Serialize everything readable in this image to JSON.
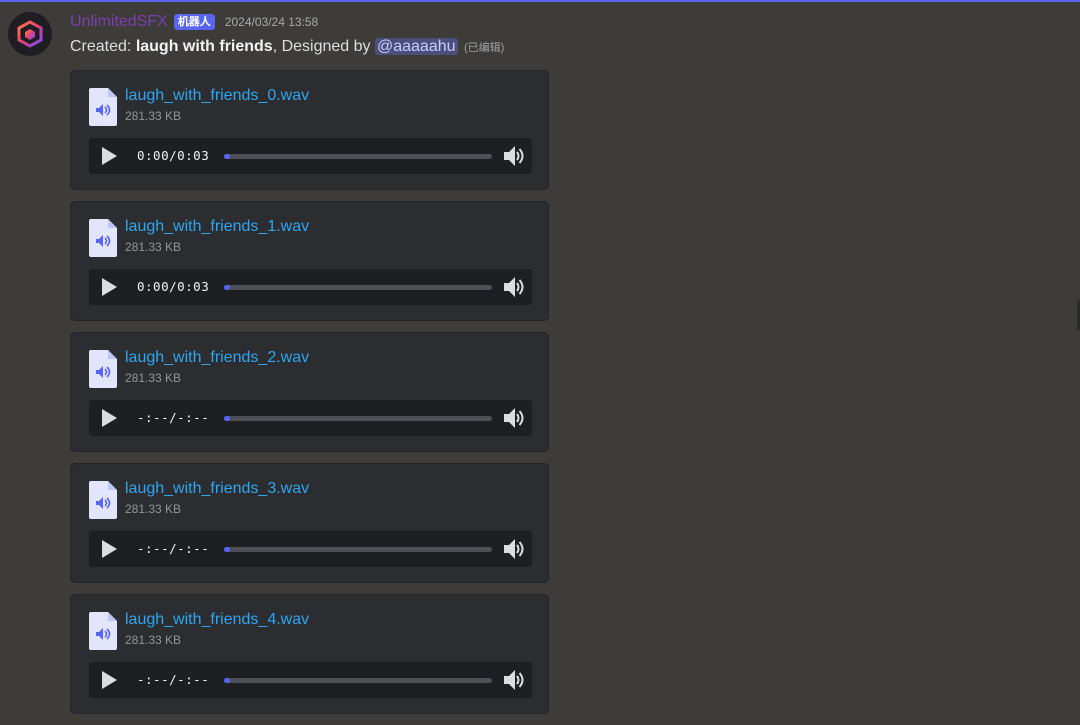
{
  "message": {
    "username": "UnlimitedSFX",
    "bot_badge": "机器人",
    "timestamp": "2024/03/24 13:58",
    "content_prefix": "Created: ",
    "content_bold": "laugh with friends",
    "content_mid": ", Designed by ",
    "mention": "@aaaaahu",
    "edited": "(已编辑)"
  },
  "attachments": [
    {
      "name": "laugh_with_friends_0.wav",
      "size": "281.33 KB",
      "time": "0:00/0:03",
      "progress": 0.0
    },
    {
      "name": "laugh_with_friends_1.wav",
      "size": "281.33 KB",
      "time": "0:00/0:03",
      "progress": 0.0
    },
    {
      "name": "laugh_with_friends_2.wav",
      "size": "281.33 KB",
      "time": "-:--/-:--",
      "progress": 0.0
    },
    {
      "name": "laugh_with_friends_3.wav",
      "size": "281.33 KB",
      "time": "-:--/-:--",
      "progress": 0.0
    },
    {
      "name": "laugh_with_friends_4.wav",
      "size": "281.33 KB",
      "time": "-:--/-:--",
      "progress": 0.0
    }
  ],
  "colors": {
    "accent": "#5865f2",
    "link": "#2ea6f0",
    "username": "#7d3fb0",
    "background": "#3d3c38",
    "attachment_bg": "#2b2d31"
  },
  "icons": {
    "file": "audio-file-icon",
    "play": "play-icon",
    "volume": "volume-icon",
    "avatar": "cube-logo-icon"
  }
}
